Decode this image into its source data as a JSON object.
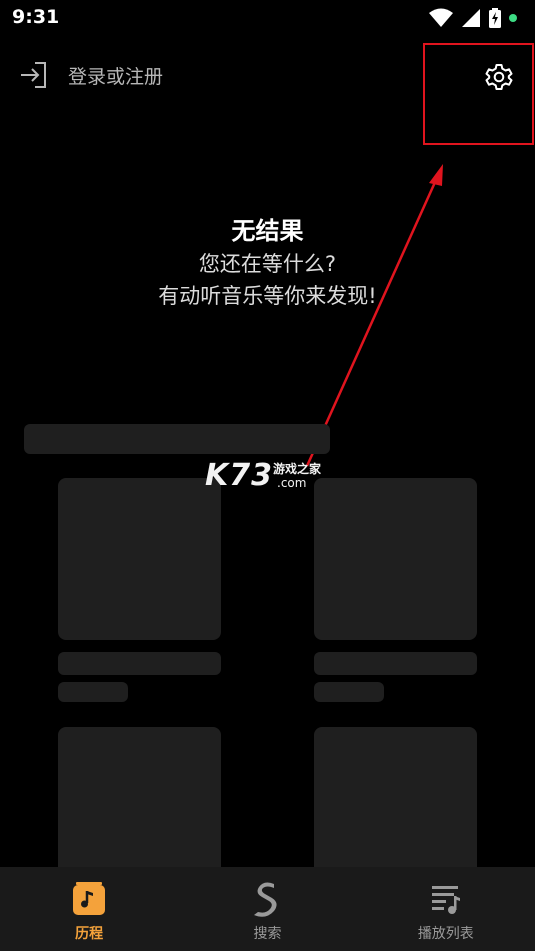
{
  "status_bar": {
    "time": "9:31"
  },
  "header": {
    "login_label": "登录或注册"
  },
  "empty_state": {
    "title": "无结果",
    "line1": "您还在等什么?",
    "line2": "有动听音乐等你来发现!"
  },
  "watermark": {
    "logo": "K73",
    "cn": "游戏之家",
    "com": ".com"
  },
  "bottom_nav": {
    "items": [
      {
        "label": "历程",
        "icon": "music-note-icon",
        "active": true
      },
      {
        "label": "搜索",
        "icon": "search-s-icon",
        "active": false
      },
      {
        "label": "播放列表",
        "icon": "playlist-icon",
        "active": false
      }
    ]
  },
  "colors": {
    "accent": "#f4a23b",
    "annotation": "#e0141e",
    "skeleton": "#1f1f1f",
    "nav_bg": "#1a1a1a"
  }
}
